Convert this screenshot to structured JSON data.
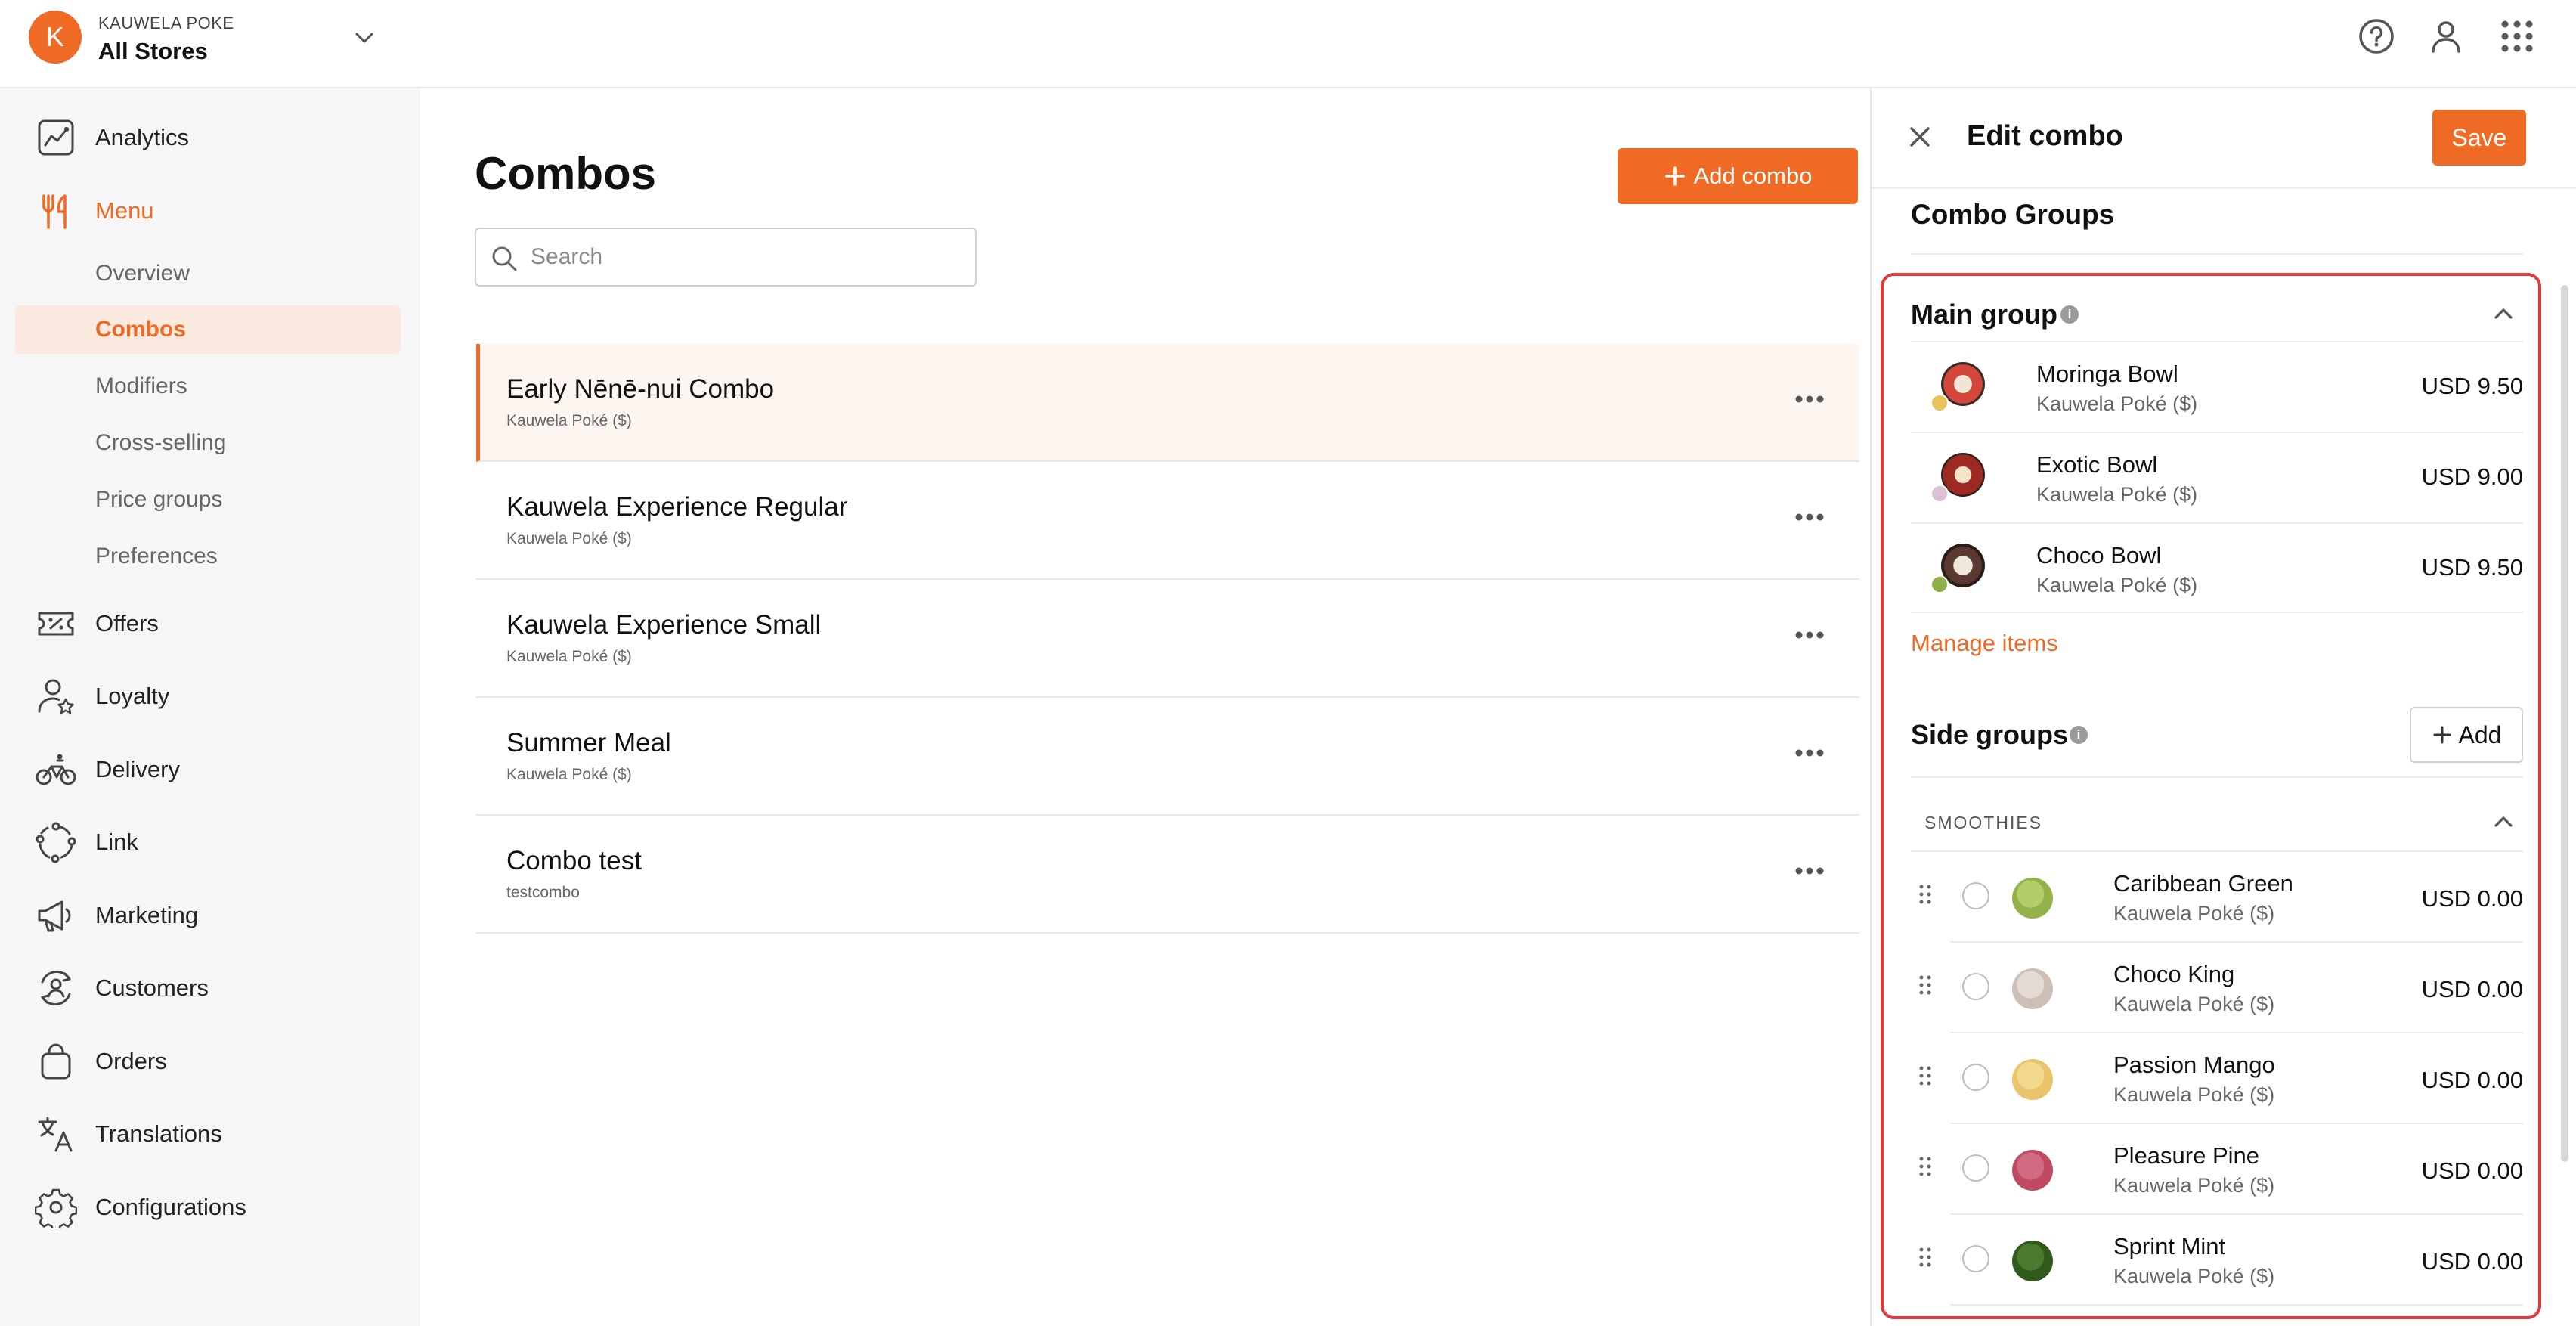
{
  "org": {
    "initial": "K",
    "name": "KAUWELA POKE",
    "store": "All Stores"
  },
  "topbar": {
    "icons": [
      "help-icon",
      "user-icon",
      "apps-grid-icon"
    ]
  },
  "sidebar": {
    "items": [
      {
        "label": "Analytics",
        "icon": "analytics-icon"
      },
      {
        "label": "Menu",
        "icon": "fork-knife-icon",
        "active": true
      },
      {
        "label": "Offers",
        "icon": "offers-icon"
      },
      {
        "label": "Loyalty",
        "icon": "loyalty-icon"
      },
      {
        "label": "Delivery",
        "icon": "bicycle-icon"
      },
      {
        "label": "Link",
        "icon": "link-icon"
      },
      {
        "label": "Marketing",
        "icon": "megaphone-icon"
      },
      {
        "label": "Customers",
        "icon": "customers-icon"
      },
      {
        "label": "Orders",
        "icon": "bag-icon"
      },
      {
        "label": "Translations",
        "icon": "translate-icon"
      },
      {
        "label": "Configurations",
        "icon": "gear-icon"
      }
    ],
    "menu_subitems": [
      {
        "label": "Overview"
      },
      {
        "label": "Combos",
        "active": true
      },
      {
        "label": "Modifiers"
      },
      {
        "label": "Cross-selling"
      },
      {
        "label": "Price groups"
      },
      {
        "label": "Preferences"
      }
    ]
  },
  "main": {
    "title": "Combos",
    "add_button": "Add combo",
    "search_placeholder": "Search",
    "combos": [
      {
        "name": "Early Nēnē-nui Combo",
        "sub": "Kauwela Poké ($)",
        "selected": true
      },
      {
        "name": "Kauwela Experience Regular",
        "sub": "Kauwela Poké ($)"
      },
      {
        "name": "Kauwela Experience Small",
        "sub": "Kauwela Poké ($)"
      },
      {
        "name": "Summer Meal",
        "sub": "Kauwela Poké ($)"
      },
      {
        "name": "Combo test",
        "sub": "testcombo"
      }
    ]
  },
  "panel": {
    "title": "Edit combo",
    "save": "Save",
    "groups_heading": "Combo Groups",
    "main_group": {
      "title": "Main group",
      "items": [
        {
          "name": "Moringa Bowl",
          "sub": "Kauwela Poké ($)",
          "price": "USD 9.50",
          "colors": [
            "#d3483a",
            "#e9c25c"
          ]
        },
        {
          "name": "Exotic Bowl",
          "sub": "Kauwela Poké ($)",
          "price": "USD 9.00",
          "colors": [
            "#9c2a22",
            "#dcc0d6"
          ]
        },
        {
          "name": "Choco Bowl",
          "sub": "Kauwela Poké ($)",
          "price": "USD 9.50",
          "colors": [
            "#5a3a30",
            "#8fb046"
          ]
        }
      ],
      "manage": "Manage items"
    },
    "side_groups": {
      "title": "Side groups",
      "add": "Add",
      "category": "SMOOTHIES",
      "items": [
        {
          "name": "Caribbean Green",
          "sub": "Kauwela Poké ($)",
          "price": "USD 0.00",
          "color": "#93b24a"
        },
        {
          "name": "Choco King",
          "sub": "Kauwela Poké ($)",
          "price": "USD 0.00",
          "color": "#cdbfb6"
        },
        {
          "name": "Passion Mango",
          "sub": "Kauwela Poké ($)",
          "price": "USD 0.00",
          "color": "#e9c46b"
        },
        {
          "name": "Pleasure Pine",
          "sub": "Kauwela Poké ($)",
          "price": "USD 0.00",
          "color": "#c04a62"
        },
        {
          "name": "Sprint Mint",
          "sub": "Kauwela Poké ($)",
          "price": "USD 0.00",
          "color": "#2f5a1c"
        }
      ]
    }
  },
  "colors": {
    "accent": "#ef6a24",
    "highlight": "#e03a3a"
  }
}
